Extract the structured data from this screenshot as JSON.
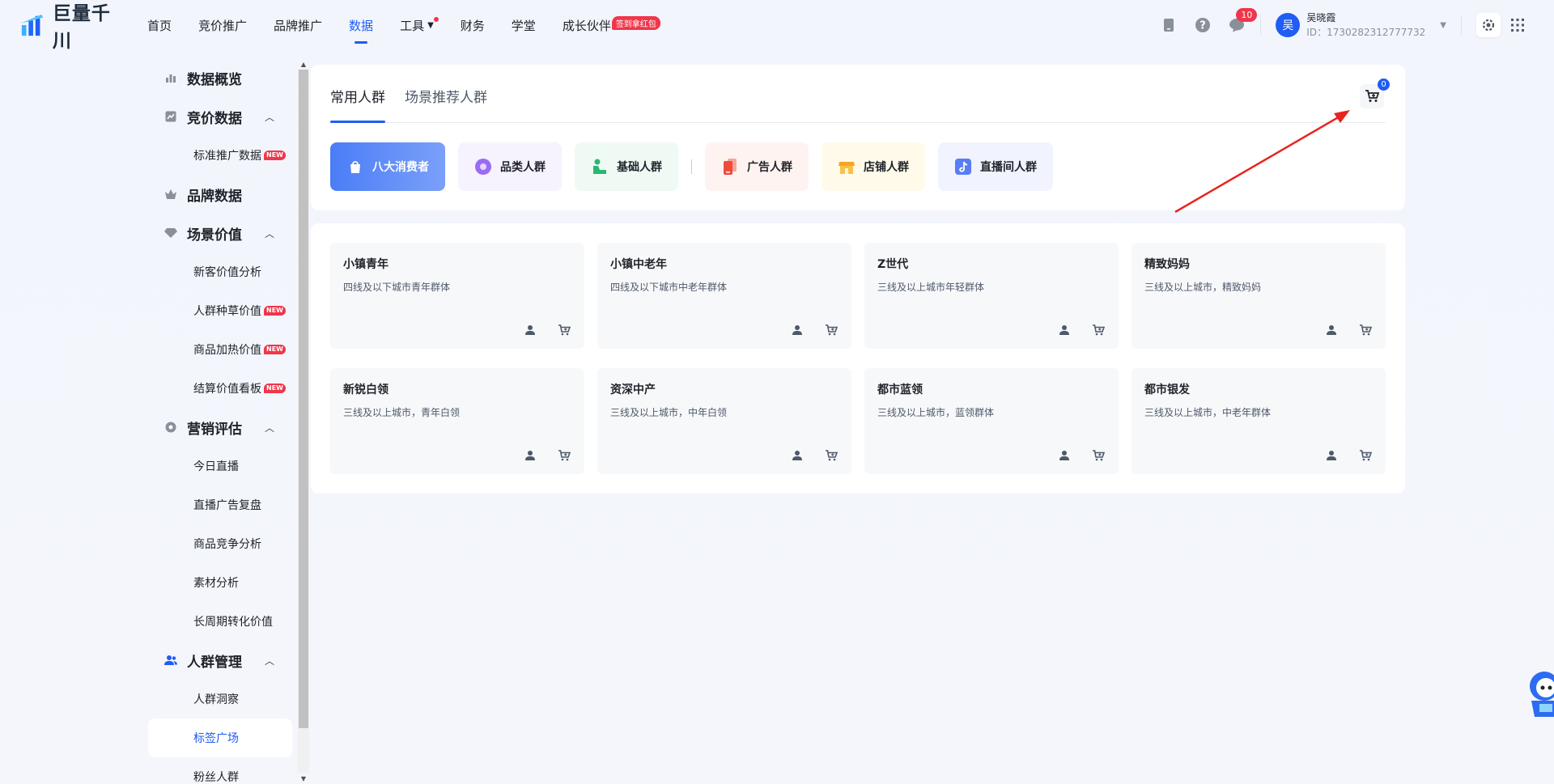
{
  "brand": {
    "logo_text": "巨量千川"
  },
  "nav": [
    {
      "label": "首页"
    },
    {
      "label": "竞价推广"
    },
    {
      "label": "品牌推广"
    },
    {
      "label": "数据"
    },
    {
      "label": "工具"
    },
    {
      "label": "财务"
    },
    {
      "label": "学堂"
    },
    {
      "label": "成长伙伴",
      "badge": "签到拿红包"
    }
  ],
  "header": {
    "message_count": "10",
    "user_avatar": "吴",
    "user_name": "吴晓霞",
    "user_id": "ID：1730282312777732"
  },
  "sidebar": {
    "groups": [
      {
        "label": "数据概览",
        "icon": "chart-icon"
      },
      {
        "label": "竞价数据",
        "icon": "trend-icon",
        "items": [
          {
            "label": "标准推广数据",
            "badge": "NEW"
          }
        ]
      },
      {
        "label": "品牌数据",
        "icon": "crown-icon"
      },
      {
        "label": "场景价值",
        "icon": "diamond-icon",
        "items": [
          {
            "label": "新客价值分析"
          },
          {
            "label": "人群种草价值",
            "badge": "NEW"
          },
          {
            "label": "商品加热价值",
            "badge": "NEW"
          },
          {
            "label": "结算价值看板",
            "badge": "NEW"
          }
        ]
      },
      {
        "label": "营销评估",
        "icon": "target-icon",
        "items": [
          {
            "label": "今日直播"
          },
          {
            "label": "直播广告复盘"
          },
          {
            "label": "商品竞争分析"
          },
          {
            "label": "素材分析"
          },
          {
            "label": "长周期转化价值"
          }
        ]
      },
      {
        "label": "人群管理",
        "icon": "users-icon",
        "items": [
          {
            "label": "人群洞察"
          },
          {
            "label": "标签广场"
          },
          {
            "label": "粉丝人群"
          }
        ]
      }
    ]
  },
  "tabs": [
    {
      "label": "常用人群"
    },
    {
      "label": "场景推荐人群"
    }
  ],
  "cart": {
    "count": "0"
  },
  "chips": [
    {
      "label": "八大消费者",
      "color": "#ffffff"
    },
    {
      "label": "品类人群",
      "color": "#f6f3ff"
    },
    {
      "label": "基础人群",
      "color": "#effaf4"
    },
    {
      "label": "广告人群",
      "color": "#fff3f1"
    },
    {
      "label": "店铺人群",
      "color": "#fffaea"
    },
    {
      "label": "直播间人群",
      "color": "#f1f3fe"
    }
  ],
  "cards": [
    {
      "title": "小镇青年",
      "desc": "四线及以下城市青年群体"
    },
    {
      "title": "小镇中老年",
      "desc": "四线及以下城市中老年群体"
    },
    {
      "title": "Z世代",
      "desc": "三线及以上城市年轻群体"
    },
    {
      "title": "精致妈妈",
      "desc": "三线及以上城市，精致妈妈"
    },
    {
      "title": "新锐白领",
      "desc": "三线及以上城市，青年白领"
    },
    {
      "title": "资深中产",
      "desc": "三线及以上城市，中年白领"
    },
    {
      "title": "都市蓝领",
      "desc": "三线及以上城市，蓝领群体"
    },
    {
      "title": "都市银发",
      "desc": "三线及以上城市，中老年群体"
    }
  ],
  "colors": {
    "accent": "#1f5df3",
    "badge": "#f0364a",
    "annotation_arrow": "#e8241f"
  }
}
